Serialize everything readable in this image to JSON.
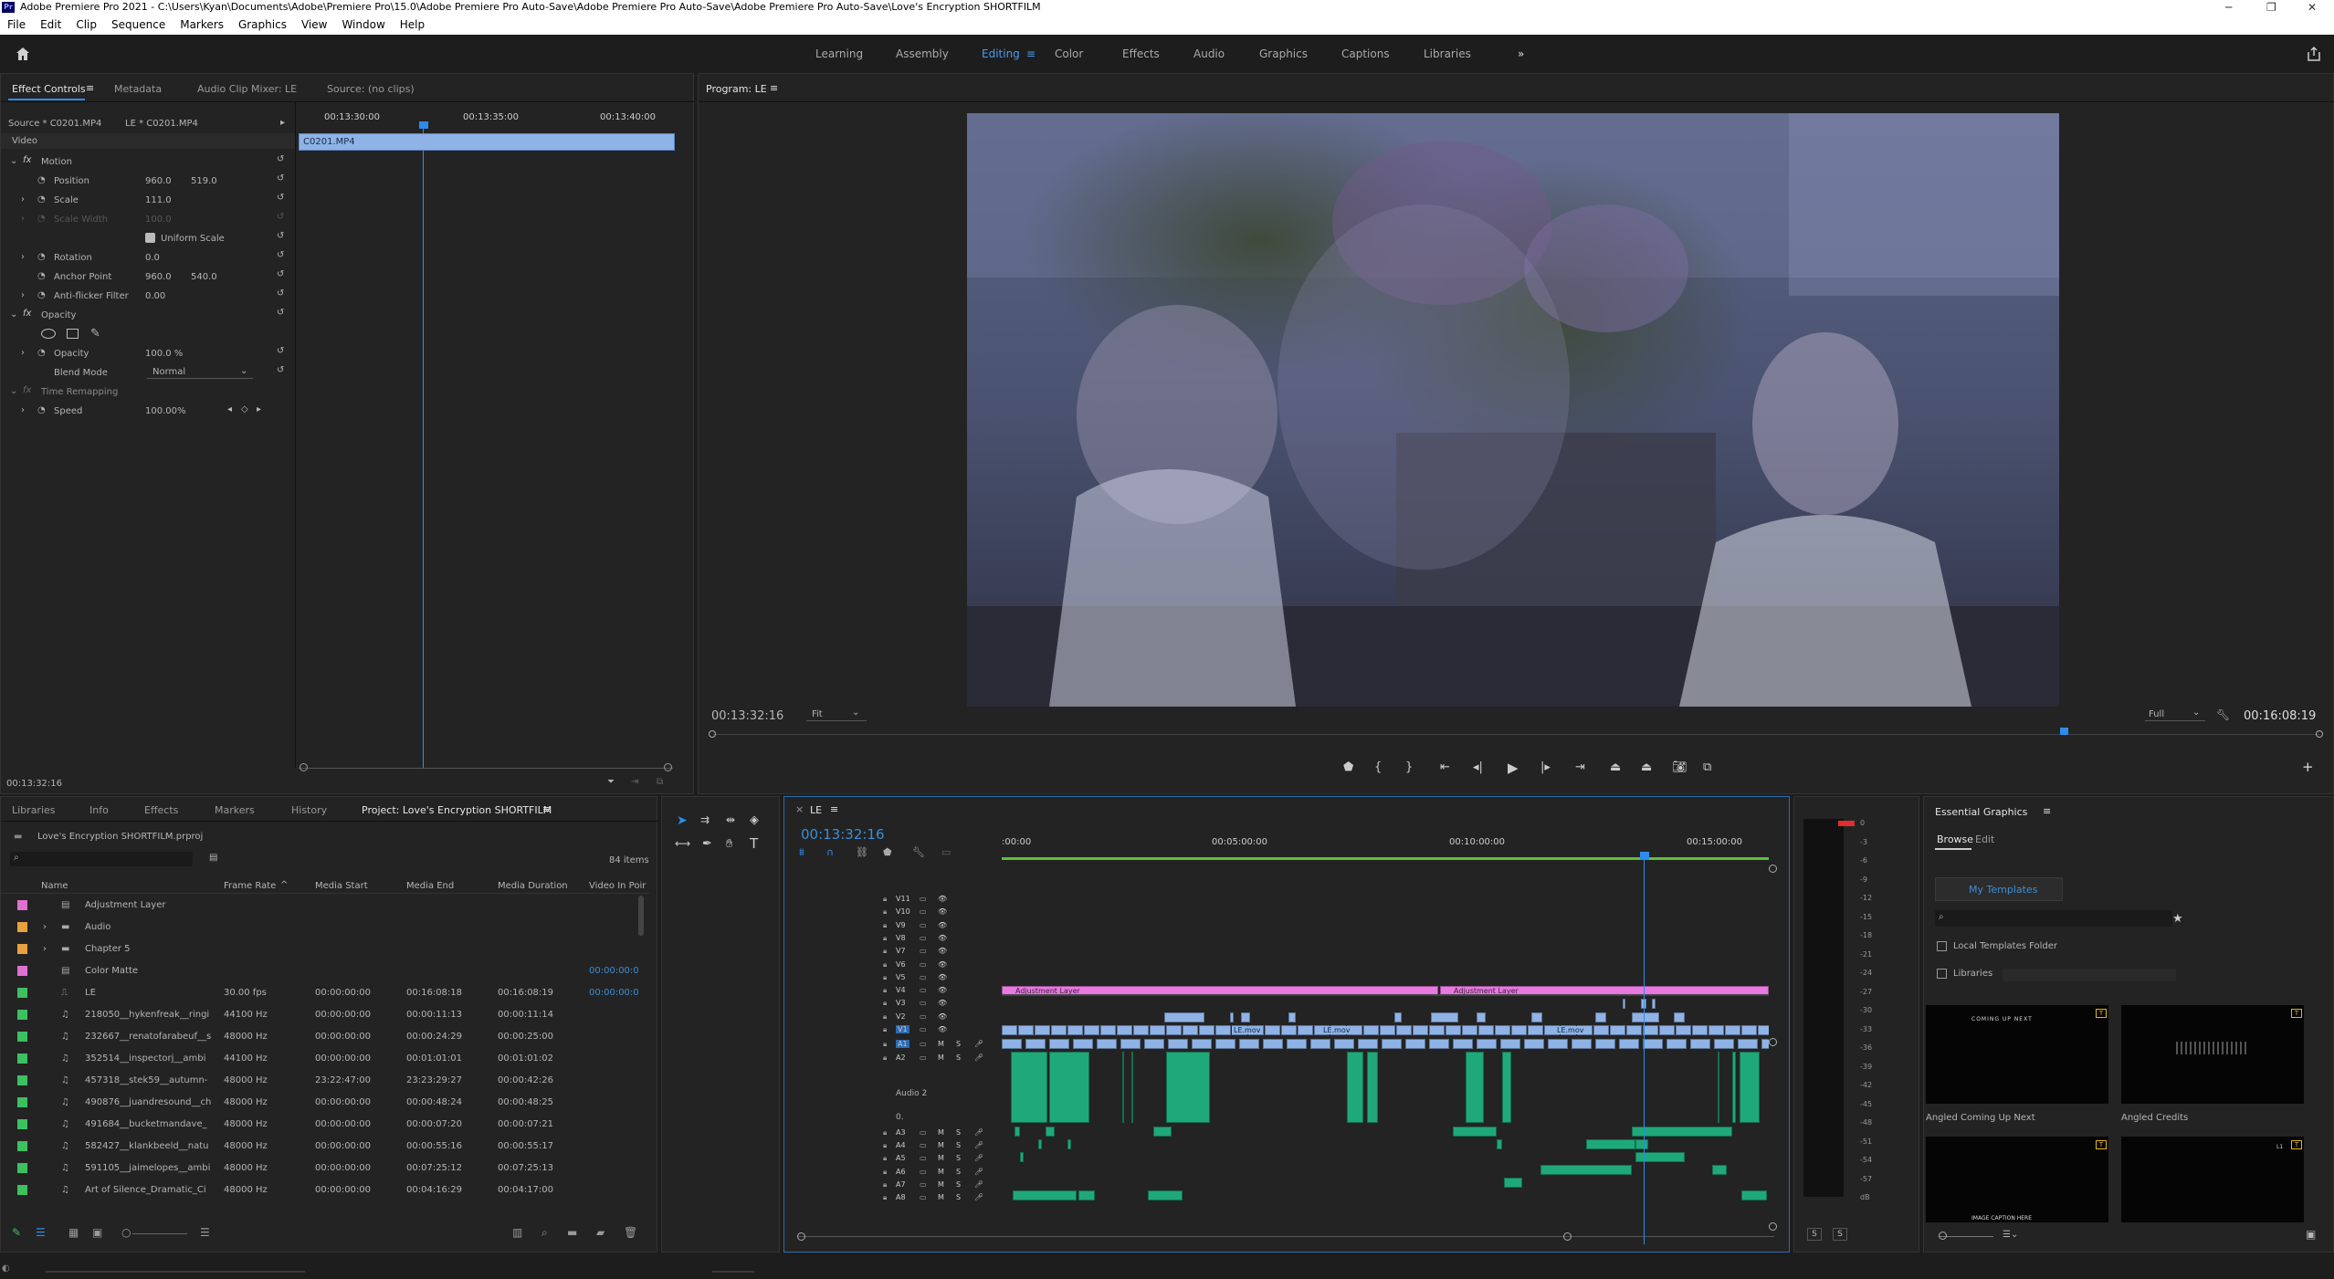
{
  "window": {
    "title": "Adobe Premiere Pro 2021 - C:\\Users\\Kyan\\Documents\\Adobe\\Premiere Pro\\15.0\\Adobe Premiere Pro Auto-Save\\Adobe Premiere Pro Auto-Save\\Adobe Premiere Pro Auto-Save\\Love's Encryption SHORTFILM",
    "app_badge": "Pr"
  },
  "menu": [
    "File",
    "Edit",
    "Clip",
    "Sequence",
    "Markers",
    "Graphics",
    "View",
    "Window",
    "Help"
  ],
  "workspaces": [
    "Learning",
    "Assembly",
    "Editing",
    "Color",
    "Effects",
    "Audio",
    "Graphics",
    "Captions",
    "Libraries"
  ],
  "workspace_active": "Editing",
  "effect_controls": {
    "tabs": [
      "Effect Controls",
      "Metadata",
      "Audio Clip Mixer: LE",
      "Source: (no clips)"
    ],
    "source_label": "Source * C0201.MP4",
    "sequence_label": "LE * C0201.MP4",
    "timecodes": [
      "00:13:30:00",
      "00:13:35:00",
      "00:13:40:00"
    ],
    "clip_name": "C0201.MP4",
    "section_video": "Video",
    "motion": "Motion",
    "position_label": "Position",
    "position_x": "960.0",
    "position_y": "519.0",
    "scale_label": "Scale",
    "scale_value": "111.0",
    "scale_width_label": "Scale Width",
    "scale_width_value": "100.0",
    "uniform_scale": "Uniform Scale",
    "rotation_label": "Rotation",
    "rotation_value": "0.0",
    "anchor_label": "Anchor Point",
    "anchor_x": "960.0",
    "anchor_y": "540.0",
    "antiflicker_label": "Anti-flicker Filter",
    "antiflicker_value": "0.00",
    "opacity_section": "Opacity",
    "opacity_label": "Opacity",
    "opacity_value": "100.0 %",
    "blend_label": "Blend Mode",
    "blend_value": "Normal",
    "time_remap": "Time Remapping",
    "speed_label": "Speed",
    "speed_value": "100.00%",
    "current_time": "00:13:32:16"
  },
  "program": {
    "tab": "Program: LE",
    "timecode": "00:13:32:16",
    "fit": "Fit",
    "quality": "Full",
    "duration": "00:16:08:19"
  },
  "project": {
    "tabs": [
      "Libraries",
      "Info",
      "Effects",
      "Markers",
      "History",
      "Project: Love's Encryption SHORTFILM"
    ],
    "file": "Love's Encryption SHORTFILM.prproj",
    "items_count": "84 items",
    "columns": [
      "Name",
      "Frame Rate",
      "Media Start",
      "Media End",
      "Media Duration",
      "Video In Poir"
    ],
    "rows": [
      {
        "color": "#e070d0",
        "type": "item",
        "name": "Adjustment Layer",
        "fr": "",
        "ms": "",
        "me": "",
        "md": "",
        "vi": ""
      },
      {
        "color": "#e8a040",
        "type": "folder",
        "name": "Audio",
        "fr": "",
        "ms": "",
        "me": "",
        "md": "",
        "vi": ""
      },
      {
        "color": "#e8a040",
        "type": "folder",
        "name": "Chapter 5",
        "fr": "",
        "ms": "",
        "me": "",
        "md": "",
        "vi": ""
      },
      {
        "color": "#e070d0",
        "type": "item",
        "name": "Color Matte",
        "fr": "",
        "ms": "",
        "me": "",
        "md": "",
        "vi": "00:00:00:0"
      },
      {
        "color": "#3cc060",
        "type": "seq",
        "name": "LE",
        "fr": "30.00 fps",
        "ms": "00:00:00:00",
        "me": "00:16:08:18",
        "md": "00:16:08:19",
        "vi": "00:00:00:0"
      },
      {
        "color": "#3cc060",
        "type": "audio",
        "name": "218050__hykenfreak__ringi",
        "fr": "44100 Hz",
        "ms": "00:00:00:00",
        "me": "00:00:11:13",
        "md": "00:00:11:14",
        "vi": ""
      },
      {
        "color": "#3cc060",
        "type": "audio",
        "name": "232667__renatofarabeuf__s",
        "fr": "48000 Hz",
        "ms": "00:00:00:00",
        "me": "00:00:24:29",
        "md": "00:00:25:00",
        "vi": ""
      },
      {
        "color": "#3cc060",
        "type": "audio",
        "name": "352514__inspectorj__ambi",
        "fr": "44100 Hz",
        "ms": "00:00:00:00",
        "me": "00:01:01:01",
        "md": "00:01:01:02",
        "vi": ""
      },
      {
        "color": "#3cc060",
        "type": "audio",
        "name": "457318__stek59__autumn-",
        "fr": "48000 Hz",
        "ms": "23:22:47:00",
        "me": "23:23:29:27",
        "md": "00:00:42:26",
        "vi": ""
      },
      {
        "color": "#3cc060",
        "type": "audio",
        "name": "490876__juandresound__ch",
        "fr": "48000 Hz",
        "ms": "00:00:00:00",
        "me": "00:00:48:24",
        "md": "00:00:48:25",
        "vi": ""
      },
      {
        "color": "#3cc060",
        "type": "audio",
        "name": "491684__bucketmandave_",
        "fr": "48000 Hz",
        "ms": "00:00:00:00",
        "me": "00:00:07:20",
        "md": "00:00:07:21",
        "vi": ""
      },
      {
        "color": "#3cc060",
        "type": "audio",
        "name": "582427__klankbeeld__natu",
        "fr": "48000 Hz",
        "ms": "00:00:00:00",
        "me": "00:00:55:16",
        "md": "00:00:55:17",
        "vi": ""
      },
      {
        "color": "#3cc060",
        "type": "audio",
        "name": "591105__jaimelopes__ambi",
        "fr": "48000 Hz",
        "ms": "00:00:00:00",
        "me": "00:07:25:12",
        "md": "00:07:25:13",
        "vi": ""
      },
      {
        "color": "#3cc060",
        "type": "audio",
        "name": "Art of Silence_Dramatic_Ci",
        "fr": "48000 Hz",
        "ms": "00:00:00:00",
        "me": "00:04:16:29",
        "md": "00:04:17:00",
        "vi": ""
      }
    ]
  },
  "timeline": {
    "tab": "LE",
    "timecode": "00:13:32:16",
    "ruler": [
      ":00:00",
      "00:05:00:00",
      "00:10:00:00",
      "00:15:00:00"
    ],
    "video_tracks": [
      "V11",
      "V10",
      "V9",
      "V8",
      "V7",
      "V6",
      "V5",
      "V4",
      "V3",
      "V2",
      "V1"
    ],
    "audio_tracks": [
      "A1",
      "A2",
      "A3",
      "A4",
      "A5",
      "A6",
      "A7",
      "A8"
    ],
    "audio2_name": "Audio 2",
    "audio2_vol": "0.",
    "adj_label": "Adjustment Layer",
    "le_mov": "LE.mov",
    "track_m": "M",
    "track_s": "S"
  },
  "meter": {
    "scale": [
      "0",
      "-3",
      "-6",
      "-9",
      "-12",
      "-15",
      "-18",
      "-21",
      "-24",
      "-27",
      "-30",
      "-33",
      "-36",
      "-39",
      "-42",
      "-45",
      "-48",
      "-51",
      "-54",
      "-57",
      "dB"
    ],
    "solo": [
      "S",
      "S"
    ]
  },
  "essential_graphics": {
    "title": "Essential Graphics",
    "tabs": [
      "Browse",
      "Edit"
    ],
    "my_templates": "My Templates",
    "local_folder": "Local Templates Folder",
    "libraries": "Libraries",
    "templates": [
      {
        "name": "Angled Coming Up Next",
        "thumb": "COMING UP NEXT"
      },
      {
        "name": "Angled Credits",
        "thumb": ""
      },
      {
        "name": "",
        "thumb": "IMAGE CAPTION HERE"
      },
      {
        "name": "",
        "thumb": "L1"
      }
    ]
  },
  "colors": {
    "accent": "#2d8ceb",
    "adjustment": "#e879e0",
    "audio_clip": "#1fa97a",
    "video_clip": "#8fb3e6",
    "panel": "#232323"
  }
}
